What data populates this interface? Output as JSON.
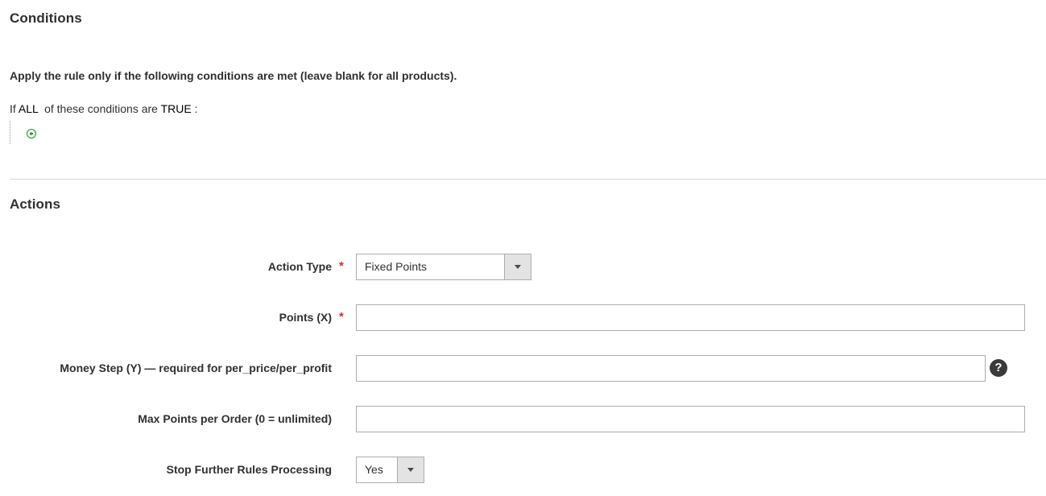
{
  "conditions": {
    "title": "Conditions",
    "intro": "Apply the rule only if the following conditions are met (leave blank for all products).",
    "line": {
      "prefix": "If ",
      "aggregator": "ALL",
      "middle": "  of these conditions are ",
      "value": "TRUE",
      "suffix": " :"
    },
    "add_icon": "add-condition-icon"
  },
  "actions": {
    "title": "Actions",
    "required_mark": "*",
    "fields": {
      "action_type": {
        "label": "Action Type",
        "value": "Fixed Points",
        "required": true
      },
      "points": {
        "label": "Points (X)",
        "value": "",
        "required": true
      },
      "money_step": {
        "label": "Money Step (Y) — required for per_price/per_profit",
        "value": "",
        "help_icon": "question-icon",
        "help_glyph": "?"
      },
      "max_points": {
        "label": "Max Points per Order (0 = unlimited)",
        "value": ""
      },
      "stop_rules": {
        "label": "Stop Further Rules Processing",
        "value": "Yes"
      }
    }
  },
  "colors": {
    "required": "#e02b27",
    "add_icon": "#2f8f3a",
    "text": "#303030",
    "border": "#adadad"
  }
}
